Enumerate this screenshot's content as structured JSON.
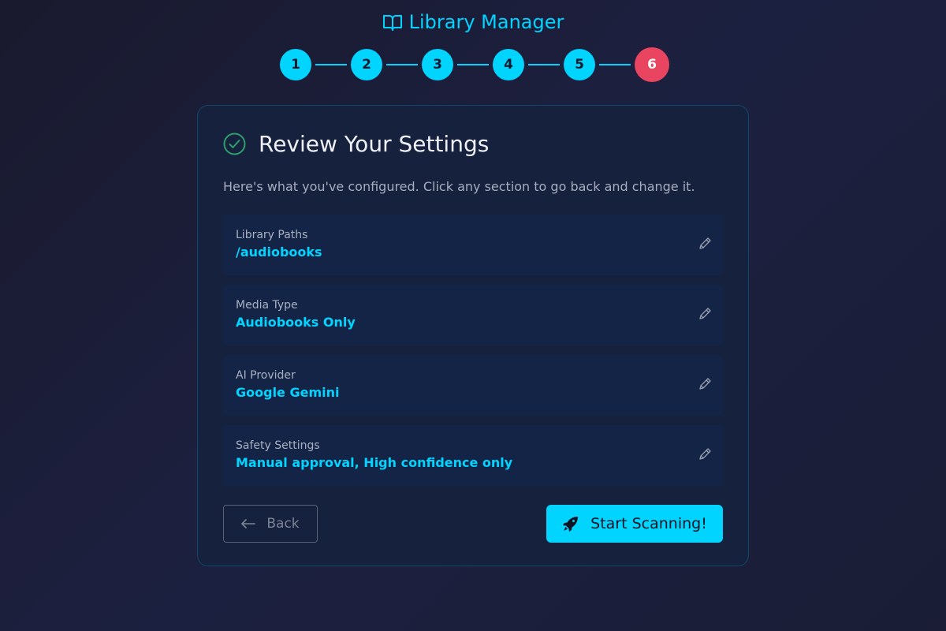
{
  "app": {
    "title": "Library Manager",
    "icon": "book-open-icon"
  },
  "stepper": {
    "steps": [
      "1",
      "2",
      "3",
      "4",
      "5",
      "6"
    ],
    "active_step": "6",
    "colors": {
      "done": "#00d4ff",
      "active": "#e94560"
    }
  },
  "card": {
    "title": "Review Your Settings",
    "subtitle": "Here's what you've configured. Click any section to go back and change it.",
    "settings": [
      {
        "label": "Library Paths",
        "value": "/audiobooks"
      },
      {
        "label": "Media Type",
        "value": "Audiobooks Only"
      },
      {
        "label": "AI Provider",
        "value": "Google Gemini"
      },
      {
        "label": "Safety Settings",
        "value": "Manual approval, High confidence only"
      }
    ]
  },
  "actions": {
    "back_label": "Back",
    "start_label": "Start Scanning!"
  },
  "colors": {
    "accent": "#00d4ff",
    "active_step": "#e94560",
    "success_check": "#2e9e6b"
  }
}
